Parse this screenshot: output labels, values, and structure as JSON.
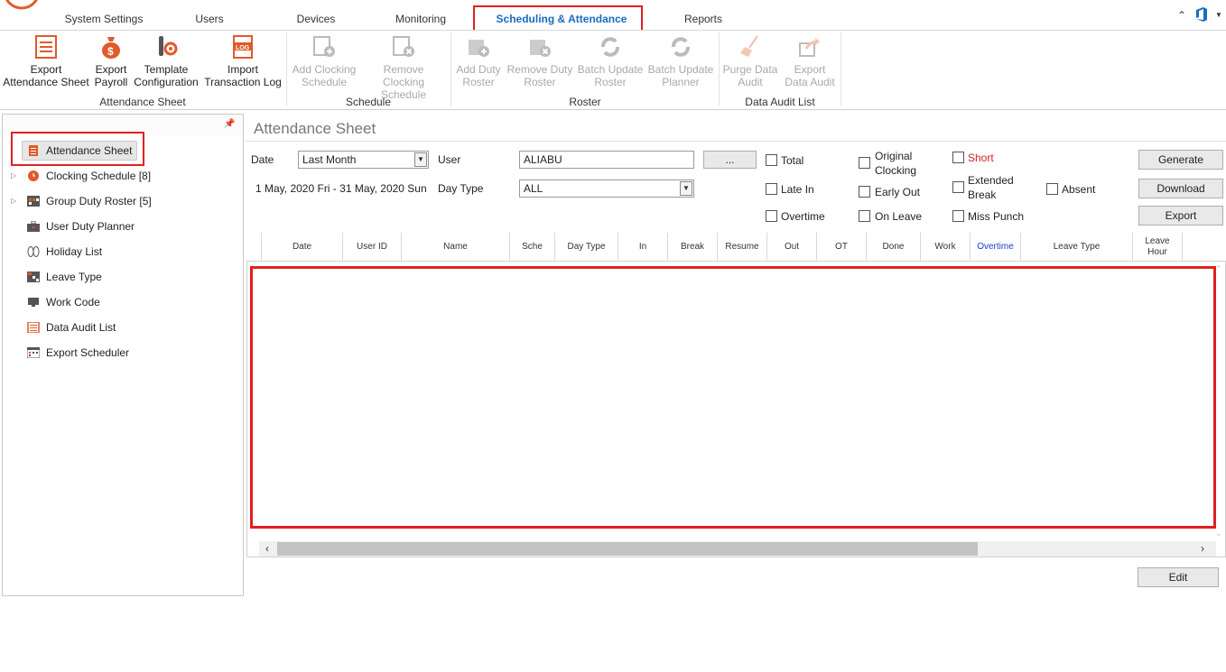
{
  "menu": {
    "tabs": [
      {
        "label": "System Settings"
      },
      {
        "label": "Users"
      },
      {
        "label": "Devices"
      },
      {
        "label": "Monitoring"
      },
      {
        "label": "Scheduling & Attendance"
      },
      {
        "label": "Reports"
      }
    ],
    "active_index": 4
  },
  "ribbon": {
    "groups": [
      {
        "label": "Attendance Sheet"
      },
      {
        "label": "Schedule"
      },
      {
        "label": "Roster"
      },
      {
        "label": "Data Audit List"
      }
    ],
    "buttons": [
      {
        "line1": "Export",
        "line2": "Attendance Sheet",
        "icon": "export-sheet-icon",
        "enabled": true
      },
      {
        "line1": "Export",
        "line2": "Payroll",
        "icon": "money-bag-icon",
        "enabled": true
      },
      {
        "line1": "Template",
        "line2": "Configuration",
        "icon": "tools-gear-icon",
        "enabled": true
      },
      {
        "line1": "Import",
        "line2": "Transaction Log",
        "icon": "log-file-icon",
        "enabled": true
      },
      {
        "line1": "Add Clocking",
        "line2": "Schedule",
        "icon": "add-schedule-icon",
        "enabled": false
      },
      {
        "line1": "Remove Clocking",
        "line2": "Schedule",
        "icon": "remove-schedule-icon",
        "enabled": false
      },
      {
        "line1": "Add Duty",
        "line2": "Roster",
        "icon": "add-roster-icon",
        "enabled": false
      },
      {
        "line1": "Remove Duty",
        "line2": "Roster",
        "icon": "remove-roster-icon",
        "enabled": false
      },
      {
        "line1": "Batch Update",
        "line2": "Roster",
        "icon": "refresh-icon",
        "enabled": false
      },
      {
        "line1": "Batch Update",
        "line2": "Planner",
        "icon": "refresh-icon",
        "enabled": false
      },
      {
        "line1": "Purge Data",
        "line2": "Audit",
        "icon": "broom-icon",
        "enabled": false
      },
      {
        "line1": "Export",
        "line2": "Data Audit",
        "icon": "share-export-icon",
        "enabled": false
      }
    ]
  },
  "sidebar": {
    "items": [
      {
        "label": "Attendance Sheet",
        "icon": "clipboard-icon",
        "expandable": false
      },
      {
        "label": "Clocking Schedule [8]",
        "icon": "clock-icon",
        "expandable": true
      },
      {
        "label": "Group Duty Roster [5]",
        "icon": "calendar-grid-icon",
        "expandable": true
      },
      {
        "label": "User Duty Planner",
        "icon": "briefcase-icon",
        "expandable": false
      },
      {
        "label": "Holiday List",
        "icon": "flip-flops-icon",
        "expandable": false
      },
      {
        "label": "Leave Type",
        "icon": "table-icon",
        "expandable": false
      },
      {
        "label": "Work Code",
        "icon": "monitor-icon",
        "expandable": false
      },
      {
        "label": "Data Audit List",
        "icon": "list-doc-icon",
        "expandable": false
      },
      {
        "label": "Export Scheduler",
        "icon": "schedule-calendar-icon",
        "expandable": false
      }
    ],
    "selected_index": 0
  },
  "main": {
    "title": "Attendance Sheet",
    "date_label": "Date",
    "date_value": "Last Month",
    "date_range": "1 May, 2020 Fri - 31 May, 2020 Sun",
    "user_label": "User",
    "user_value": "ALIABU",
    "browse_label": "...",
    "daytype_label": "Day Type",
    "daytype_value": "ALL",
    "checkboxes": {
      "total": "Total",
      "late_in": "Late In",
      "overtime": "Overtime",
      "original_clocking_1": "Original",
      "original_clocking_2": "Clocking",
      "early_out": "Early Out",
      "on_leave": "On Leave",
      "short": "Short",
      "extended_break_1": "Extended",
      "extended_break_2": "Break",
      "miss_punch": "Miss Punch",
      "absent": "Absent"
    },
    "buttons": {
      "generate": "Generate",
      "download": "Download",
      "export": "Export",
      "edit": "Edit"
    },
    "grid_columns": [
      {
        "label": "Date"
      },
      {
        "label": "User ID"
      },
      {
        "label": "Name"
      },
      {
        "label": "Sche"
      },
      {
        "label": "Day Type"
      },
      {
        "label": "In"
      },
      {
        "label": "Break"
      },
      {
        "label": "Resume"
      },
      {
        "label": "Out"
      },
      {
        "label": "OT"
      },
      {
        "label": "Done"
      },
      {
        "label": "Work"
      },
      {
        "label": "Overtime"
      },
      {
        "label": "Leave Type"
      },
      {
        "label": "Leave Hour"
      }
    ],
    "colors": {
      "accent": "#1a6bbf",
      "highlight": "#e02020",
      "short_text": "#d42020",
      "overtime_header": "#1e3fc8"
    }
  }
}
